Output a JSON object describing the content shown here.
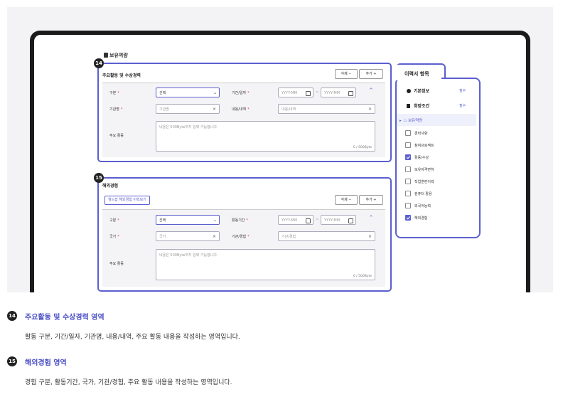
{
  "section_title": "보유역량",
  "panel14": {
    "badge": "14",
    "title": "주요활동 및 수상경력",
    "delete_label": "삭제 −",
    "add_label": "추가 +",
    "category_label": "구분",
    "category_value": "선택",
    "period_label": "기간/일자",
    "date_start_placeholder": "YYYY-MM",
    "date_end_placeholder": "YYYY-MM",
    "org_label": "기관명",
    "org_placeholder": "기관명",
    "content_label": "내용/내역",
    "content_placeholder": "내용/내역",
    "activity_label": "주요 활동",
    "activity_placeholder": "내용은 500Byte까지 입력 가능합니다.",
    "counter": "0 / 500Byte",
    "tilde": "~"
  },
  "panel15": {
    "badge": "15",
    "title": "해외경험",
    "load_button": "월드잡 해외경험 이력보기",
    "delete_label": "삭제 −",
    "add_label": "추가 +",
    "category_label": "구분",
    "category_value": "선택",
    "period_label": "활동기간",
    "date_start_placeholder": "YYYY-MM",
    "date_end_placeholder": "YYYY-MM",
    "country_label": "국가",
    "country_placeholder": "국가",
    "org_label": "기관/경험",
    "org_placeholder": "기관/경험",
    "activity_label": "주요 활동",
    "activity_placeholder": "내용은 500Byte까지 입력 가능합니다.",
    "counter": "0 / 500Byte",
    "tilde": "~"
  },
  "sidebar": {
    "title": "이력서 항목",
    "basic_info": "기본정보",
    "desired_conditions": "희망조건",
    "required_label": "필수",
    "competency": "보유역량",
    "items": [
      {
        "label": "경력사항",
        "checked": false
      },
      {
        "label": "참여프로젝트",
        "checked": false
      },
      {
        "label": "활동/수상",
        "checked": true
      },
      {
        "label": "보유자격면허",
        "checked": false
      },
      {
        "label": "직업훈련이력",
        "checked": false
      },
      {
        "label": "컴퓨터 활용",
        "checked": false
      },
      {
        "label": "외국어능력",
        "checked": false
      },
      {
        "label": "해외경험",
        "checked": true
      }
    ]
  },
  "descriptions": [
    {
      "badge": "14",
      "title": "주요활동 및 수상경력 영역",
      "text": "활동 구분, 기간/일자, 기관명, 내용/내역, 주요 활동 내용을 작성하는 영역입니다."
    },
    {
      "badge": "15",
      "title": "해외경험 영역",
      "text": "경험 구분, 활동기간, 국가, 기관/경험, 주요 활동 내용을 작성하는 영역입니다."
    }
  ],
  "colors": {
    "accent": "#5b5fcf",
    "required": "#e03030",
    "device": "#1b1b1b"
  }
}
